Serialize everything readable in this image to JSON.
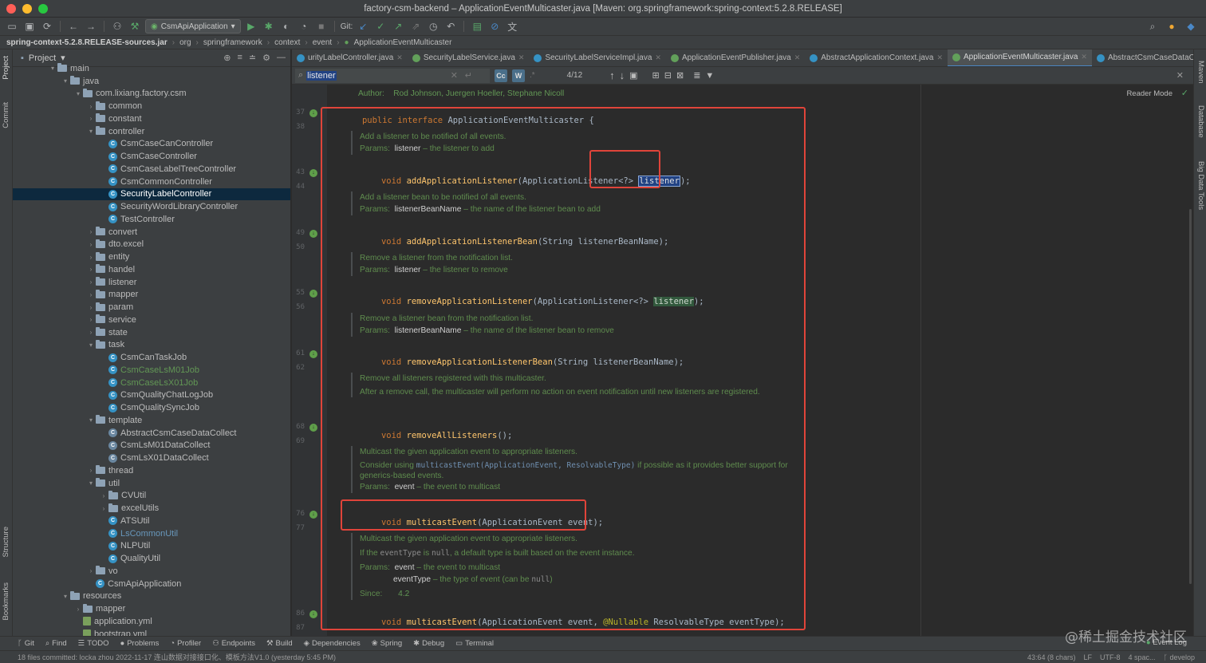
{
  "window": {
    "title": "factory-csm-backend – ApplicationEventMulticaster.java [Maven: org.springframework:spring-context:5.2.8.RELEASE]"
  },
  "toolbar": {
    "run_config": "CsmApiApplication",
    "git_label": "Git:"
  },
  "breadcrumb": [
    "spring-context-5.2.8.RELEASE-sources.jar",
    "org",
    "springframework",
    "context",
    "event",
    "ApplicationEventMulticaster"
  ],
  "project": {
    "title": "Project",
    "items": [
      {
        "label": "main",
        "kind": "folder",
        "level": 4,
        "open": true
      },
      {
        "label": "java",
        "kind": "folder",
        "level": 5,
        "open": true
      },
      {
        "label": "com.lixiang.factory.csm",
        "kind": "folder",
        "level": 6,
        "open": true
      },
      {
        "label": "common",
        "kind": "folder",
        "level": 7
      },
      {
        "label": "constant",
        "kind": "folder",
        "level": 7
      },
      {
        "label": "controller",
        "kind": "folder",
        "level": 7,
        "open": true
      },
      {
        "label": "CsmCaseCanController",
        "kind": "class",
        "level": 8
      },
      {
        "label": "CsmCaseController",
        "kind": "class",
        "level": 8
      },
      {
        "label": "CsmCaseLabelTreeController",
        "kind": "class",
        "level": 8
      },
      {
        "label": "CsmCommonController",
        "kind": "class",
        "level": 8
      },
      {
        "label": "SecurityLabelController",
        "kind": "class",
        "level": 8,
        "selected": true
      },
      {
        "label": "SecurityWordLibraryController",
        "kind": "class",
        "level": 8
      },
      {
        "label": "TestController",
        "kind": "class",
        "level": 8
      },
      {
        "label": "convert",
        "kind": "folder",
        "level": 7
      },
      {
        "label": "dto.excel",
        "kind": "folder",
        "level": 7
      },
      {
        "label": "entity",
        "kind": "folder",
        "level": 7
      },
      {
        "label": "handel",
        "kind": "folder",
        "level": 7
      },
      {
        "label": "listener",
        "kind": "folder",
        "level": 7
      },
      {
        "label": "mapper",
        "kind": "folder",
        "level": 7
      },
      {
        "label": "param",
        "kind": "folder",
        "level": 7
      },
      {
        "label": "service",
        "kind": "folder",
        "level": 7
      },
      {
        "label": "state",
        "kind": "folder",
        "level": 7
      },
      {
        "label": "task",
        "kind": "folder",
        "level": 7,
        "open": true
      },
      {
        "label": "CsmCanTaskJob",
        "kind": "class",
        "level": 8
      },
      {
        "label": "CsmCaseLsM01Job",
        "kind": "class",
        "level": 8,
        "color": "green"
      },
      {
        "label": "CsmCaseLsX01Job",
        "kind": "class",
        "level": 8,
        "color": "green"
      },
      {
        "label": "CsmQualityChatLogJob",
        "kind": "class",
        "level": 8
      },
      {
        "label": "CsmQualitySyncJob",
        "kind": "class",
        "level": 8
      },
      {
        "label": "template",
        "kind": "folder",
        "level": 7,
        "open": true
      },
      {
        "label": "AbstractCsmCaseDataCollect",
        "kind": "abstract",
        "level": 8
      },
      {
        "label": "CsmLsM01DataCollect",
        "kind": "abstract",
        "level": 8
      },
      {
        "label": "CsmLsX01DataCollect",
        "kind": "abstract",
        "level": 8
      },
      {
        "label": "thread",
        "kind": "folder",
        "level": 7
      },
      {
        "label": "util",
        "kind": "folder",
        "level": 7,
        "open": true
      },
      {
        "label": "CVUtil",
        "kind": "folder",
        "level": 8
      },
      {
        "label": "excelUtils",
        "kind": "folder",
        "level": 8
      },
      {
        "label": "ATSUtil",
        "kind": "class",
        "level": 8
      },
      {
        "label": "LsCommonUtil",
        "kind": "class",
        "level": 8,
        "color": "blue"
      },
      {
        "label": "NLPUtil",
        "kind": "class",
        "level": 8
      },
      {
        "label": "QualityUtil",
        "kind": "class",
        "level": 8
      },
      {
        "label": "vo",
        "kind": "folder",
        "level": 7
      },
      {
        "label": "CsmApiApplication",
        "kind": "class",
        "level": 7
      },
      {
        "label": "resources",
        "kind": "folder",
        "level": 5,
        "open": true
      },
      {
        "label": "mapper",
        "kind": "folder",
        "level": 6
      },
      {
        "label": "application.yml",
        "kind": "yml",
        "level": 6
      },
      {
        "label": "bootstrap.yml",
        "kind": "yml",
        "level": 6
      }
    ]
  },
  "tabs": [
    {
      "label": "urityLabelController.java",
      "icon": "class"
    },
    {
      "label": "SecurityLabelService.java",
      "icon": "interface"
    },
    {
      "label": "SecurityLabelServiceImpl.java",
      "icon": "class"
    },
    {
      "label": "ApplicationEventPublisher.java",
      "icon": "interface"
    },
    {
      "label": "AbstractApplicationContext.java",
      "icon": "class"
    },
    {
      "label": "ApplicationEventMulticaster.java",
      "icon": "interface",
      "active": true
    },
    {
      "label": "AbstractCsmCaseDataCollect.java",
      "icon": "class"
    }
  ],
  "search": {
    "query": "listener",
    "count": "4/12",
    "opt_case": "Cc",
    "opt_word": "W",
    "opt_regex": ".*"
  },
  "editor": {
    "reader_mode": "Reader Mode",
    "author_label": "Author:",
    "author_value": "Rod Johnson, Juergen Hoeller, Stephane Nicoll",
    "lines": [
      "37",
      "38",
      "43",
      "44",
      "49",
      "50",
      "55",
      "56",
      "61",
      "62",
      "68",
      "69",
      "76",
      "77",
      "86",
      "87"
    ],
    "decl": {
      "kw1": "public",
      "kw2": "interface",
      "name": "ApplicationEventMulticaster",
      "brace": "{"
    },
    "methods": [
      {
        "ret": "void",
        "name": "addApplicationListener",
        "params": "(ApplicationListener<?> ",
        "hl": "listener",
        "end": ");"
      },
      {
        "ret": "void",
        "name": "addApplicationListenerBean",
        "params": "(String listenerBeanName);"
      },
      {
        "ret": "void",
        "name": "removeApplicationListener",
        "params": "(ApplicationListener<?> ",
        "hl": "listener",
        "end": ");"
      },
      {
        "ret": "void",
        "name": "removeApplicationListenerBean",
        "params": "(String listenerBeanName);"
      },
      {
        "ret": "void",
        "name": "removeAllListeners",
        "params": "();"
      },
      {
        "ret": "void",
        "name": "multicastEvent",
        "params": "(ApplicationEvent event);"
      },
      {
        "ret": "void",
        "name": "multicastEvent",
        "params": "(ApplicationEvent event, ",
        "ann": "@Nullable",
        "end": " ResolvableType eventType);"
      }
    ],
    "docs": {
      "d1": {
        "text": "Add a listener to be notified of all events.",
        "pl": "Params:",
        "pn": "listener",
        "pd": "– the listener to add"
      },
      "d2": {
        "text": "Add a listener bean to be notified of all events.",
        "pl": "Params:",
        "pn": "listenerBeanName",
        "pd": "– the name of the listener bean to add"
      },
      "d3": {
        "text": "Remove a listener from the notification list.",
        "pl": "Params:",
        "pn": "listener",
        "pd": "– the listener to remove"
      },
      "d4": {
        "text": "Remove a listener bean from the notification list.",
        "pl": "Params:",
        "pn": "listenerBeanName",
        "pd": "– the name of the listener bean to remove"
      },
      "d5": {
        "text": "Remove all listeners registered with this multicaster.",
        "text2": "After a remove call, the multicaster will perform no action on event notification until new listeners are registered."
      },
      "d6": {
        "text": "Multicast the given application event to appropriate listeners.",
        "t2a": "Consider using ",
        "t2code": "multicastEvent(ApplicationEvent, ResolvableType)",
        "t2b": " if possible as it provides better support for generics-based events.",
        "pl": "Params:",
        "pn": "event",
        "pd": "– the event to multicast"
      },
      "d7": {
        "text": "Multicast the given application event to appropriate listeners.",
        "t2a": "If the ",
        "t2c1": "eventType",
        "t2b": " is ",
        "t2c2": "null",
        "t2d": ", a default type is built based on the event instance.",
        "pl": "Params:",
        "pn": "event",
        "pd": "– the event to multicast",
        "pn2": "eventType",
        "pd2": "– the type of event (can be ",
        "pd2c": "null",
        "pd2e": ")",
        "since_l": "Since:",
        "since_v": "4.2"
      }
    }
  },
  "bottom_tools": [
    "Git",
    "Find",
    "TODO",
    "Problems",
    "Profiler",
    "Endpoints",
    "Build",
    "Dependencies",
    "Spring",
    "Debug",
    "Terminal"
  ],
  "side_left": [
    "Project",
    "Commit",
    "Structure",
    "Bookmarks"
  ],
  "side_right": [
    "Maven",
    "Database",
    "Big Data Tools"
  ],
  "status": {
    "message": "18 files committed: locka zhou 2022-11-17 连山数据对接接口化、模板方法V1.0 (yesterday 5:45 PM)",
    "position": "43:64 (8 chars)",
    "line_sep": "LF",
    "encoding": "UTF-8",
    "indent": "4 spac...",
    "branch": "develop",
    "event_log": "Event Log"
  },
  "watermark": "@稀土掘金技术社区",
  "colors": {
    "accent": "#4a88c7",
    "annotation_red": "#e0443a",
    "selection": "#0d293e"
  }
}
